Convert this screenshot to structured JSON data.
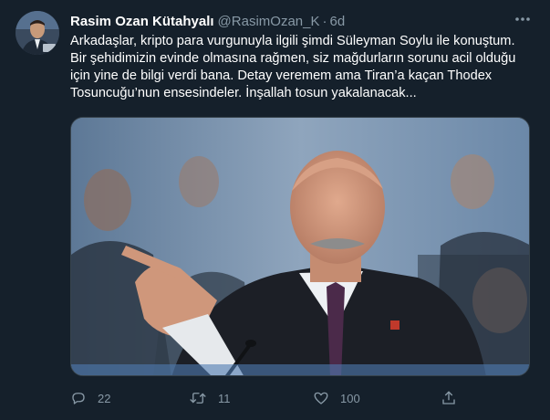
{
  "tweet": {
    "author_name": "Rasim Ozan Kütahyalı",
    "handle": "@RasimOzan_K",
    "separator": "·",
    "time": "6d",
    "text": "Arkadaşlar, kripto para vurgunuyla ilgili şimdi Süleyman Soylu ile konuştum.\nBir şehidimizin evinde olmasına rağmen, siz mağdurların sorunu acil olduğu\niçin yine de bilgi verdi bana. Detay veremem ama Tiran’a kaçan Thodex\nTosuncuğu’nun ensesindeler. İnşallah tosun yakalanacak...",
    "replies": "22",
    "retweets": "11",
    "likes": "100"
  },
  "icons": {
    "more": "more-icon",
    "reply": "reply-icon",
    "retweet": "retweet-icon",
    "like": "like-icon",
    "share": "share-icon"
  },
  "colors": {
    "background": "#15202b",
    "secondary_text": "#8899a6",
    "border": "#38444d"
  }
}
